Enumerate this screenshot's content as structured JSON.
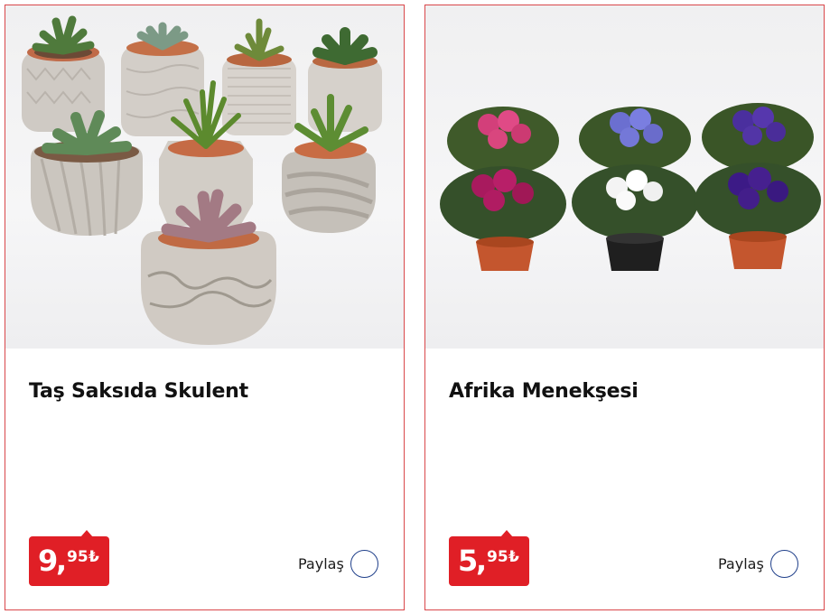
{
  "products": [
    {
      "image_alt": "stone pot succulents",
      "title": "Taş Saksıda Skulent",
      "price": {
        "main": "9",
        "comma": ",",
        "cents": "95",
        "currency": "₺"
      },
      "share_label": "Paylaş",
      "share_icon": "share-circle-icon"
    },
    {
      "image_alt": "african violets",
      "title": "Afrika Menekşesi",
      "price": {
        "main": "5",
        "comma": ",",
        "cents": "95",
        "currency": "₺"
      },
      "share_label": "Paylaş",
      "share_icon": "share-circle-icon"
    }
  ],
  "colors": {
    "card_border": "#d9474a",
    "price_badge": "#e01f26",
    "share_ring": "#1f3f8a"
  }
}
